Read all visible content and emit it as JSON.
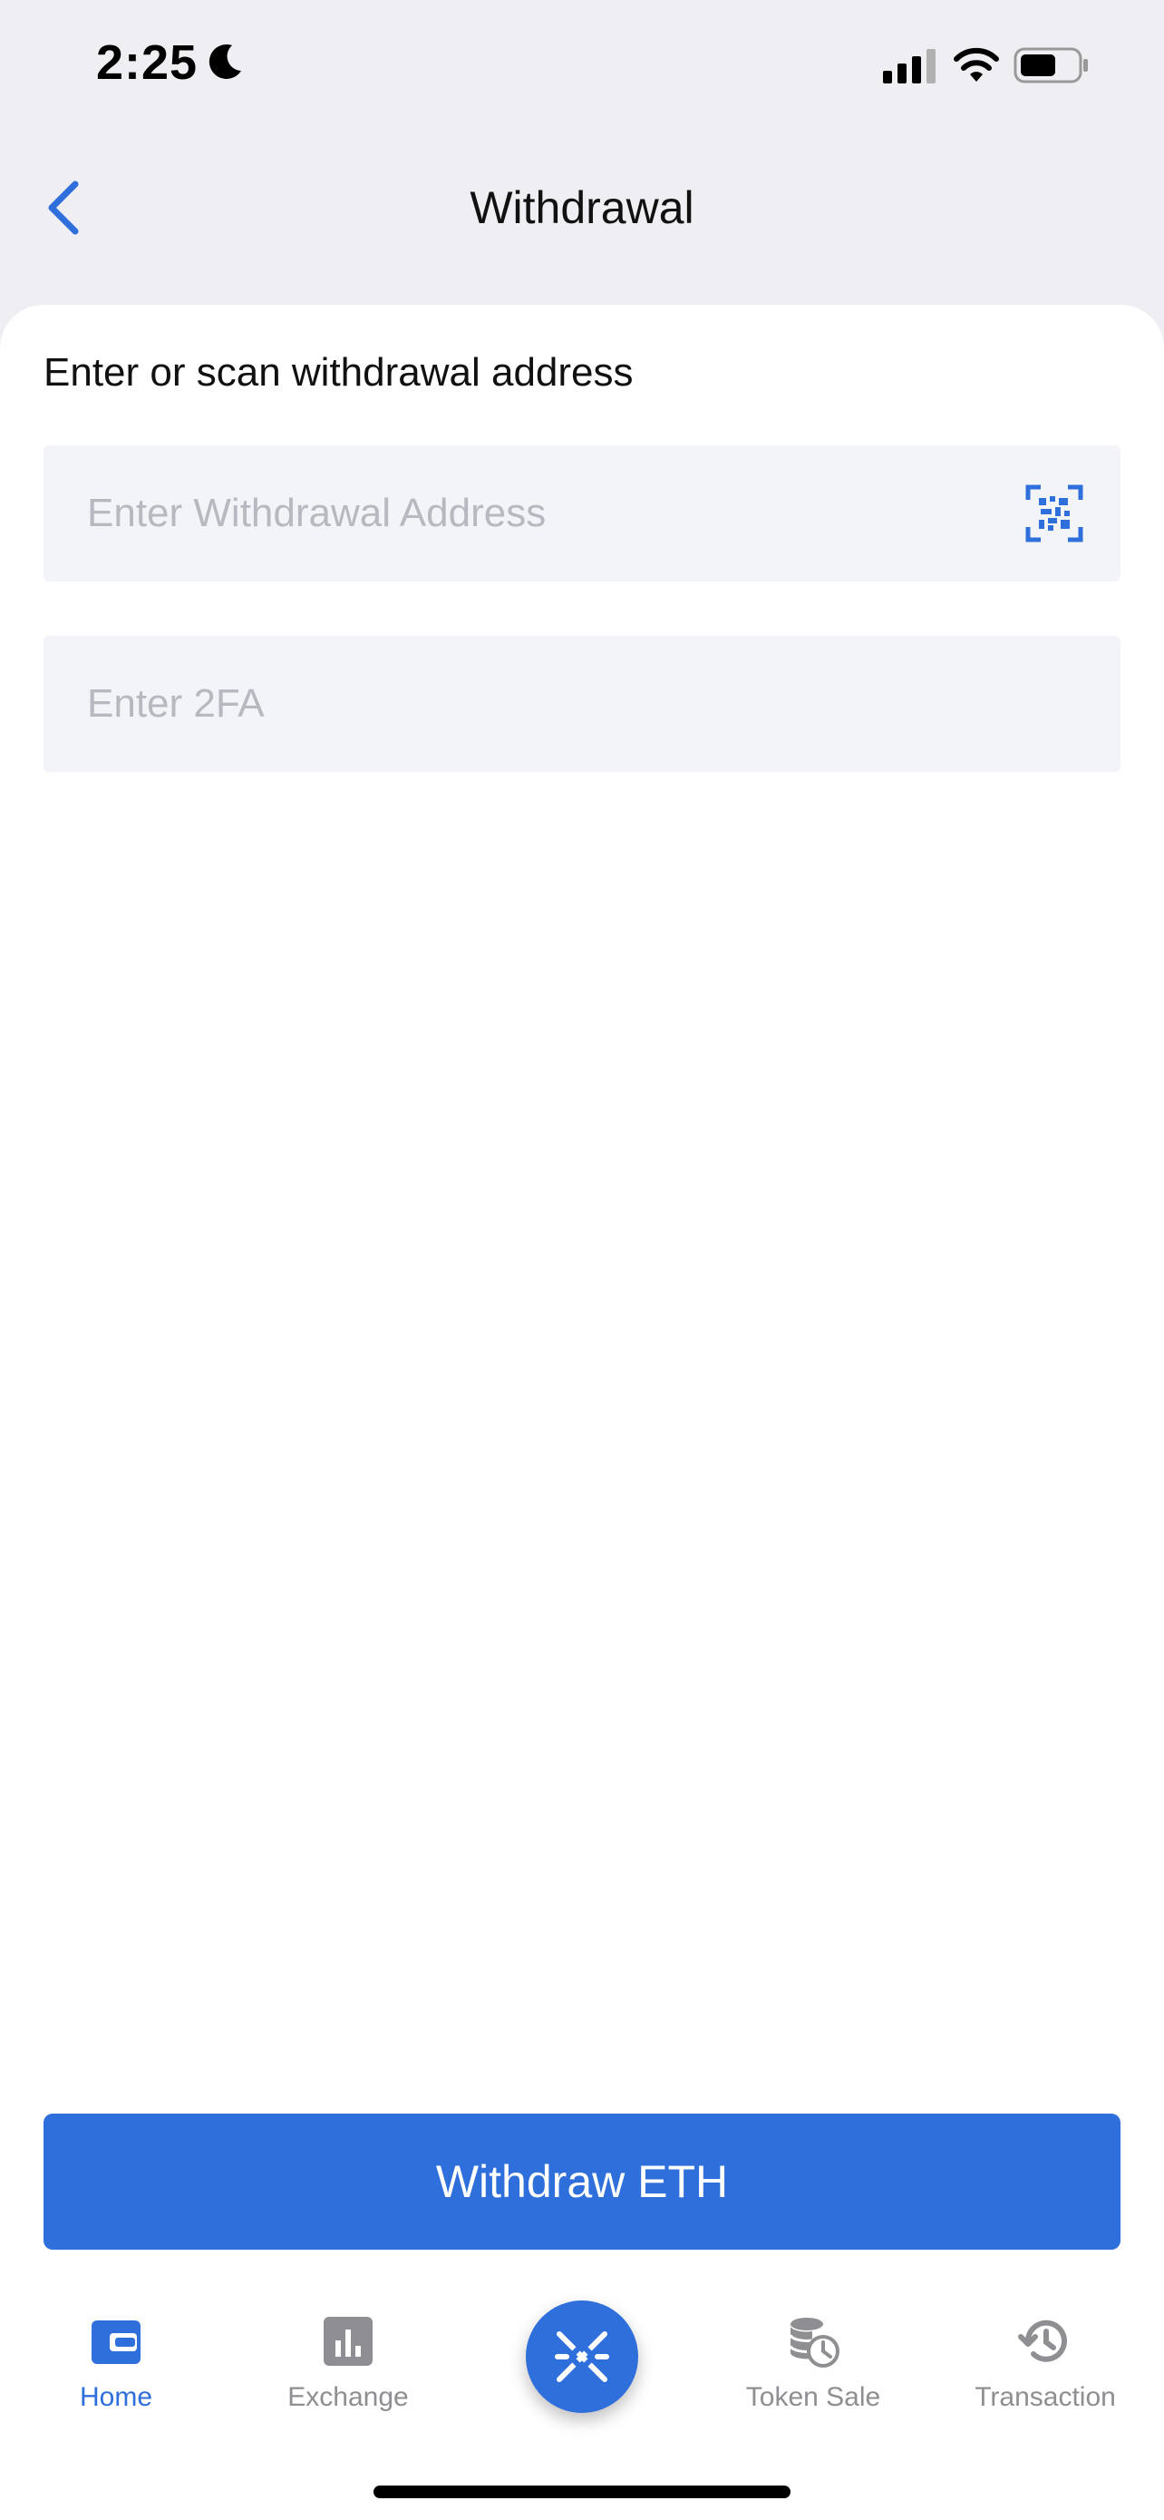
{
  "status_bar": {
    "time": "2:25",
    "icons": [
      "moon-icon",
      "signal-icon",
      "wifi-icon",
      "battery-icon"
    ]
  },
  "nav": {
    "title": "Withdrawal",
    "back_icon": "chevron-left-icon"
  },
  "form": {
    "prompt": "Enter or scan withdrawal address",
    "address_placeholder": "Enter Withdrawal Address",
    "address_value": "",
    "scan_icon": "qr-scan-icon",
    "twofa_placeholder": "Enter 2FA",
    "twofa_value": ""
  },
  "actions": {
    "withdraw_label": "Withdraw ETH"
  },
  "tabbar": {
    "tabs": [
      {
        "label": "Home",
        "icon": "wallet-icon",
        "active": true
      },
      {
        "label": "Exchange",
        "icon": "bar-chart-icon",
        "active": false
      },
      {
        "label": "",
        "icon": "app-logo-icon",
        "active": false
      },
      {
        "label": "Token Sale",
        "icon": "coins-clock-icon",
        "active": false
      },
      {
        "label": "Transaction",
        "icon": "history-icon",
        "active": false
      }
    ]
  },
  "colors": {
    "accent": "#2f6fdb",
    "background": "#eeeef3",
    "field_background": "#f3f4f8",
    "placeholder": "#b7b9c1",
    "inactive_tab": "#8e8e93"
  }
}
